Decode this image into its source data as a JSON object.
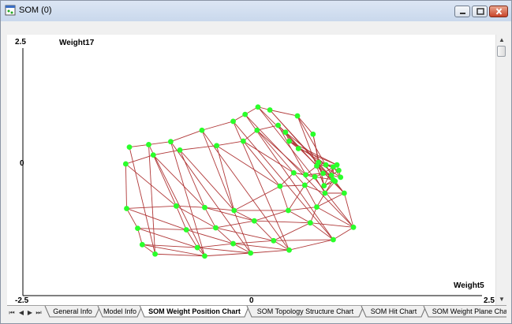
{
  "window": {
    "title": "SOM (0)"
  },
  "tabs": [
    {
      "label": "General Info",
      "active": false
    },
    {
      "label": "Model Info",
      "active": false
    },
    {
      "label": "SOM Weight Position Chart",
      "active": true
    },
    {
      "label": "SOM Topology Structure Chart",
      "active": false
    },
    {
      "label": "SOM Hit Chart",
      "active": false
    },
    {
      "label": "SOM Weight Plane Char",
      "active": false
    }
  ],
  "chart_data": {
    "type": "scatter",
    "title": "",
    "xlabel": "Weight5",
    "ylabel": "Weight17",
    "xlim": [
      -2.5,
      2.5
    ],
    "ylim": [
      -2.5,
      2.5
    ],
    "x_ticks": [
      "-2.5",
      "0",
      "2.5"
    ],
    "y_ticks": [
      "2.5",
      "0"
    ],
    "grid": false,
    "point_color": "#2aff2a",
    "edge_color": "#b03838",
    "grid_rows": 6,
    "grid_cols": 10,
    "nodes": [
      [
        -1.38,
        0.16
      ],
      [
        -1.08,
        0.34
      ],
      [
        -0.79,
        0.44
      ],
      [
        -0.39,
        0.53
      ],
      [
        -0.1,
        0.62
      ],
      [
        0.05,
        0.84
      ],
      [
        0.28,
        0.94
      ],
      [
        0.36,
        0.8
      ],
      [
        0.4,
        0.62
      ],
      [
        0.5,
        0.47
      ],
      [
        -1.37,
        -0.74
      ],
      [
        -0.83,
        -0.69
      ],
      [
        -0.52,
        -0.72
      ],
      [
        -0.2,
        -0.78
      ],
      [
        0.3,
        -0.29
      ],
      [
        0.45,
        -0.02
      ],
      [
        0.58,
        -0.06
      ],
      [
        0.7,
        0.12
      ],
      [
        0.8,
        0.14
      ],
      [
        0.92,
        0.14
      ],
      [
        -1.25,
        -1.14
      ],
      [
        -0.72,
        -1.17
      ],
      [
        -0.4,
        -1.13
      ],
      [
        0.02,
        -0.99
      ],
      [
        0.39,
        -0.78
      ],
      [
        0.57,
        -0.27
      ],
      [
        0.68,
        -0.1
      ],
      [
        0.77,
        -0.03
      ],
      [
        0.86,
        -0.07
      ],
      [
        0.94,
        0.03
      ],
      [
        -1.2,
        -1.47
      ],
      [
        -0.6,
        -1.53
      ],
      [
        -0.21,
        -1.45
      ],
      [
        0.23,
        -1.39
      ],
      [
        0.63,
        -1.03
      ],
      [
        0.7,
        -0.71
      ],
      [
        0.79,
        -0.43
      ],
      [
        0.88,
        -0.16
      ],
      [
        0.88,
        0.1
      ],
      [
        0.96,
        -0.11
      ],
      [
        -1.06,
        -1.66
      ],
      [
        -0.52,
        -1.7
      ],
      [
        -0.02,
        -1.64
      ],
      [
        0.4,
        -1.58
      ],
      [
        0.88,
        -1.37
      ],
      [
        1.1,
        -1.12
      ],
      [
        1.0,
        -0.43
      ],
      [
        0.9,
        -0.19
      ],
      [
        0.78,
        -0.28
      ],
      [
        0.72,
        0.19
      ],
      [
        -1.34,
        0.5
      ],
      [
        -1.13,
        0.55
      ],
      [
        -0.89,
        0.61
      ],
      [
        -0.55,
        0.84
      ],
      [
        -0.21,
        1.02
      ],
      [
        -0.08,
        1.16
      ],
      [
        0.06,
        1.31
      ],
      [
        0.19,
        1.25
      ],
      [
        0.49,
        1.13
      ],
      [
        0.66,
        0.76
      ]
    ]
  }
}
